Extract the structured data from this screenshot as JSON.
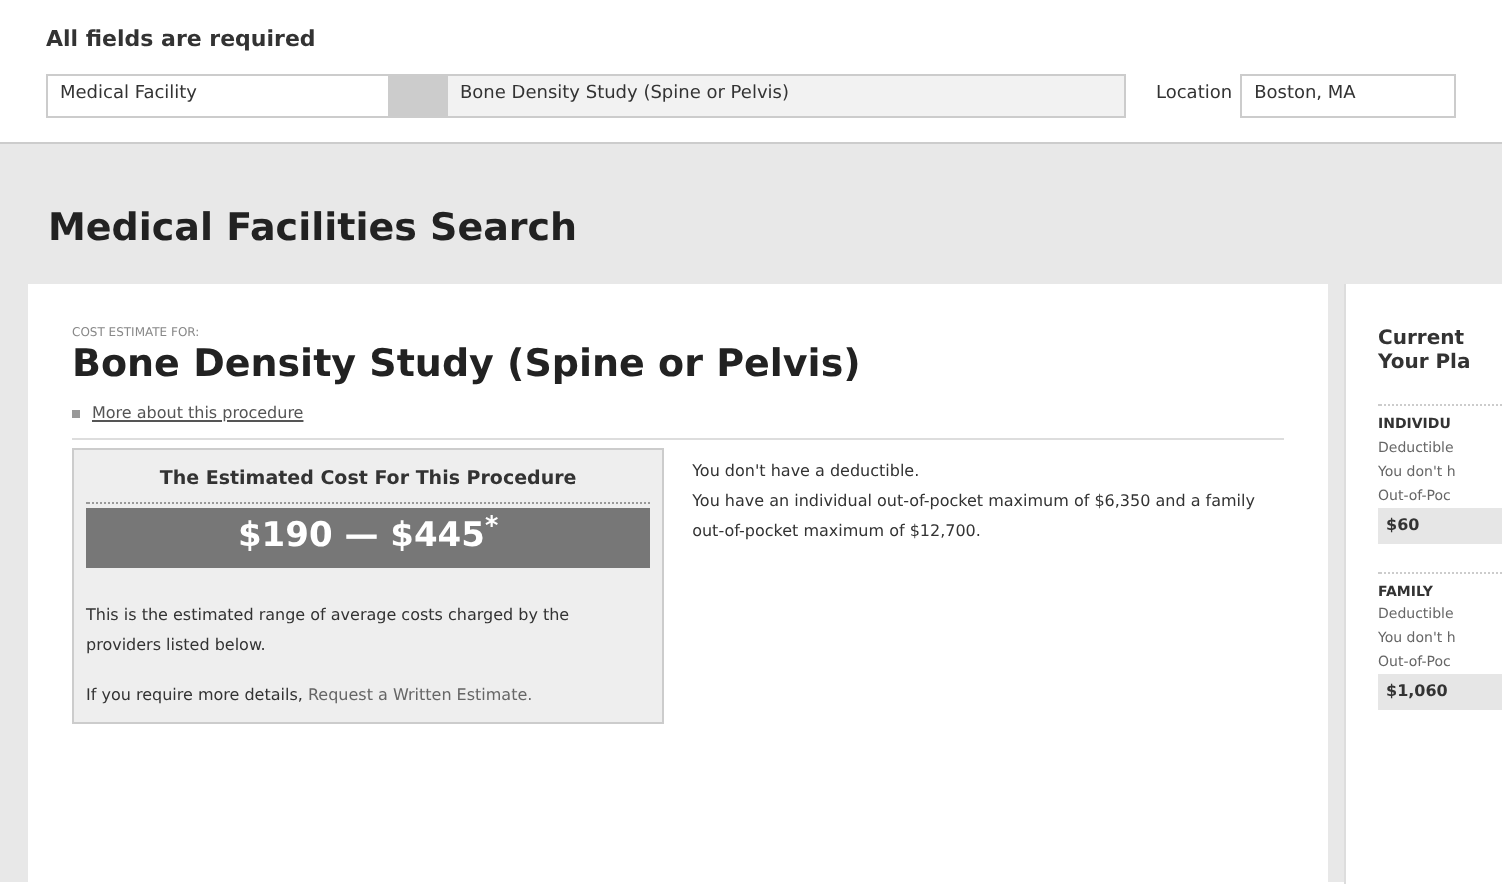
{
  "form": {
    "heading": "All fields are required",
    "facility_type": "Medical Facility",
    "procedure": "Bone Density Study (Spine or Pelvis)",
    "location_label": "Location",
    "location": "Boston, MA"
  },
  "page_title": "Medical Facilities Search",
  "estimate": {
    "eyebrow": "COST ESTIMATE FOR:",
    "procedure_title": "Bone Density Study (Spine or Pelvis)",
    "more_link": "More about this procedure",
    "box_title": "The Estimated Cost For This Procedure",
    "price": "$190 — $445$^{*}$",
    "description": "This is the estimated range of average costs charged by the providers listed below.",
    "details_prefix": "If you require more details, ",
    "details_link": "Request a Written Estimate."
  },
  "coverage": [
    "You don't have a deductible.",
    "You have an individual out-of-pocket maximum of $6,350 and a family out-of-pocket maximum of $12,700."
  ],
  "side_panel": {
    "title_lines": [
      "Current",
      "Your Pla"
    ],
    "sections": [
      {
        "heading": "INDIVIDU",
        "lines": [
          "Deductible",
          "You don't h",
          "Out-of-Poc"
        ],
        "amount": "$60"
      },
      {
        "heading": "FAMILY",
        "lines": [
          "Deductible",
          "You don't h",
          "Out-of-Poc"
        ],
        "amount": "$1,060"
      }
    ]
  }
}
